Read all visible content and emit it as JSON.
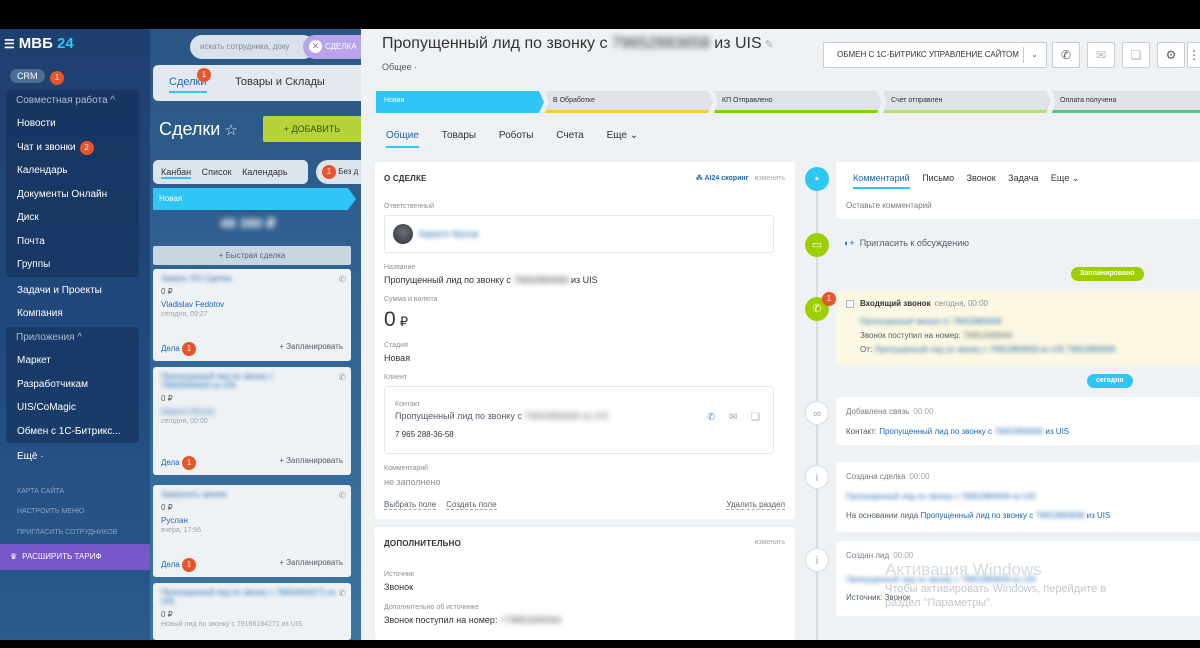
{
  "sidebar": {
    "logo_text": "МВБ",
    "logo_num": "24",
    "crm": "CRM",
    "crm_count": "1",
    "group1_title": "Совместная работа ^",
    "group1": [
      {
        "label": "Новости",
        "count": ""
      },
      {
        "label": "Чат и звонки",
        "count": "2"
      },
      {
        "label": "Календарь",
        "count": ""
      },
      {
        "label": "Документы Онлайн",
        "count": ""
      },
      {
        "label": "Диск",
        "count": ""
      },
      {
        "label": "Почта",
        "count": ""
      },
      {
        "label": "Группы",
        "count": ""
      }
    ],
    "tasks": "Задачи и Проекты",
    "company": "Компания",
    "group2_title": "Приложения ^",
    "group2": [
      "Маркет",
      "Разработчикам",
      "UIS/CoMagic",
      "Обмен с 1С-Битрикс..."
    ],
    "more": "Ещё ·",
    "small": [
      "КАРТА САЙТА",
      "НАСТРОИТЬ МЕНЮ",
      "ПРИГЛАСИТЬ СОТРУДНИКОВ"
    ],
    "tariff": "РАСШИРИТЬ ТАРИФ"
  },
  "kanban": {
    "search_placeholder": "искать сотрудника, доку",
    "search_btn": "СДЕЛКА",
    "tab_deals": "Сделки",
    "tab_deals_count": "1",
    "tab_goods": "Товары и Склады",
    "page_title": "Сделки",
    "add_btn": "ДОБАВИТЬ",
    "views": [
      "Канбан",
      "Список",
      "Календарь"
    ],
    "views_extra_count": "1",
    "views_extra": "Без д",
    "stage": "Новая",
    "stage_amount": "48 390 ₽",
    "quick": "+ Быстрая сделка",
    "cards": [
      {
        "title": "Запрос ПО Сделка",
        "currency": "0 ₽",
        "who": "Vladislav Fedotov",
        "when": "сегодня, 09:27",
        "deals": "Дела",
        "count": "1",
        "plan": "+ Запланировать"
      },
      {
        "title": "Пропущенный лид по звонку с",
        "title2": "79650000000 из UIS",
        "currency": "0 ₽",
        "who": "Кирилл Мухов",
        "when": "сегодня, 00:00",
        "deals": "Дела",
        "count": "1",
        "plan": "+ Запланировать"
      },
      {
        "title": "Запросить звонок",
        "currency": "0 ₽",
        "who": "Руслан",
        "when": "вчера, 17:56",
        "deals": "Дела",
        "count": "1",
        "plan": "+ Запланировать"
      },
      {
        "title": "Пропущенный лид по звонку с 79650000271 из",
        "title2": "UIS",
        "currency": "0 ₽",
        "who": "",
        "when": "Новый лид по звонку с 79166164271 из UIS",
        "deals": "",
        "count": "",
        "plan": ""
      }
    ]
  },
  "deal": {
    "title_prefix": "Пропущенный лид по звонку с",
    "title_phone": "79652883658",
    "title_suffix": "из UIS",
    "category": "Общее ·",
    "sync_btn": "ОБМЕН С 1С-БИТРИКС УПРАВЛЕНИЕ САЙТОМ",
    "stages": [
      "Новая",
      "В Обработке",
      "КП Отправлено",
      "Счет отправлен",
      "Оплата получена"
    ],
    "stage_colors": [
      "#2fc6f6",
      "#f2cf3a",
      "#7bd500",
      "#b6e06a",
      "#51c68b"
    ],
    "tabs": [
      "Общие",
      "Товары",
      "Роботы",
      "Счета",
      "Еще ⌄"
    ],
    "about_title": "О СДЕЛКЕ",
    "ai_label": "AI24 скоринг",
    "edit": "изменить",
    "responsible_label": "Ответственный",
    "responsible_name": "Кирилл Мухов",
    "name_label": "Название",
    "name_value_prefix": "Пропущенный лид по звонку с",
    "name_value_phone": "79652883658",
    "name_value_suffix": "из UIS",
    "sum_label": "Сумма и валюта",
    "sum_value": "0",
    "sum_currency": "₽",
    "stage_label": "Стадия",
    "stage_value": "Новая",
    "client_label": "Клиент",
    "contact_label": "Контакт",
    "contact_name_prefix": "Пропущенный лид по звонку с",
    "contact_name_blur": "79652883658 из UIS",
    "contact_phone": "7 965 288-36-58",
    "comment_label": "Комментарий",
    "comment_value": "не заполнено",
    "choose_field": "Выбрать поле",
    "create_field": "Создать поле",
    "delete_section": "Удалить раздел",
    "extra_title": "ДОПОЛНИТЕЛЬНО",
    "source_label": "Источник",
    "source_value": "Звонок",
    "source_extra_label": "Дополнительно об источнике",
    "source_extra_value": "Звонок поступил на номер:",
    "source_extra_blur": "+74951000044."
  },
  "timeline": {
    "tabs": [
      "Комментарий",
      "Письмо",
      "Звонок",
      "Задача",
      "Еще ⌄"
    ],
    "comment_ph": "Оставьте комментарий",
    "invite": "Пригласить к обсуждению",
    "planned": "Запланировано",
    "call_title": "Входящий звонок",
    "call_time": "сегодня, 00:00",
    "call_row1": "Пропущенный звонок от 79652883658",
    "call_row2_prefix": "Звонок поступил на номер:",
    "call_row2_blur": "74951000044.",
    "call_row3_prefix": "От:",
    "call_row3_blur": "Пропущенный лид по звонку с 79652883658 из UIS 79652883658",
    "call_counter": "1",
    "today": "сегодня",
    "link_title": "Добавлена связь",
    "link_time": "00:00",
    "link_label": "Контакт:",
    "link_value": "Пропущенный лид по звонку с",
    "link_blur": "79652883658",
    "link_suffix": "из UIS",
    "created_title": "Создана сделка",
    "created_time": "00:00",
    "created_row1": "Пропущенный лид по звонку с 79652883658 из UIS",
    "created_row2_prefix": "На основании лида",
    "created_row2_link": "Пропущенный лид по звонку с",
    "created_row2_blur": "79652883658",
    "created_row2_suffix": "из UIS",
    "lead_title": "Создан лид",
    "lead_time": "00:00",
    "lead_row1": "Пропущенный лид по звонку с 79652883658 из UIS",
    "lead_row2": "Источник: Звонок",
    "activation1": "Активация Windows",
    "activation2": "Чтобы активировать Windows, перейдите в",
    "activation3": "раздел \"Параметры\"."
  }
}
